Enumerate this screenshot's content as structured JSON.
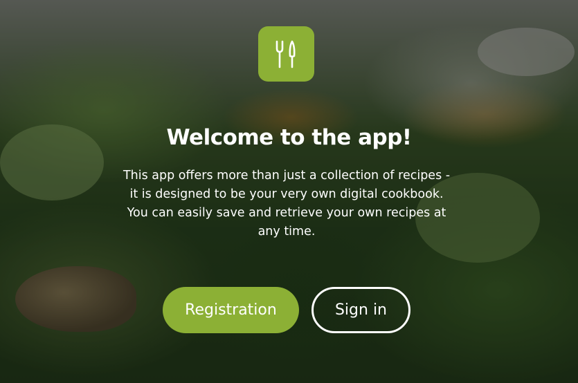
{
  "app": {
    "logo_icon": "fork-knife-icon",
    "accent_color": "#8cb035"
  },
  "welcome": {
    "title": "Welcome to the app!",
    "description": "This app offers more than just a collection of recipes - it is designed to be your very own digital cookbook. You can easily save and retrieve your own recipes at any time."
  },
  "actions": {
    "registration_label": "Registration",
    "signin_label": "Sign in"
  }
}
